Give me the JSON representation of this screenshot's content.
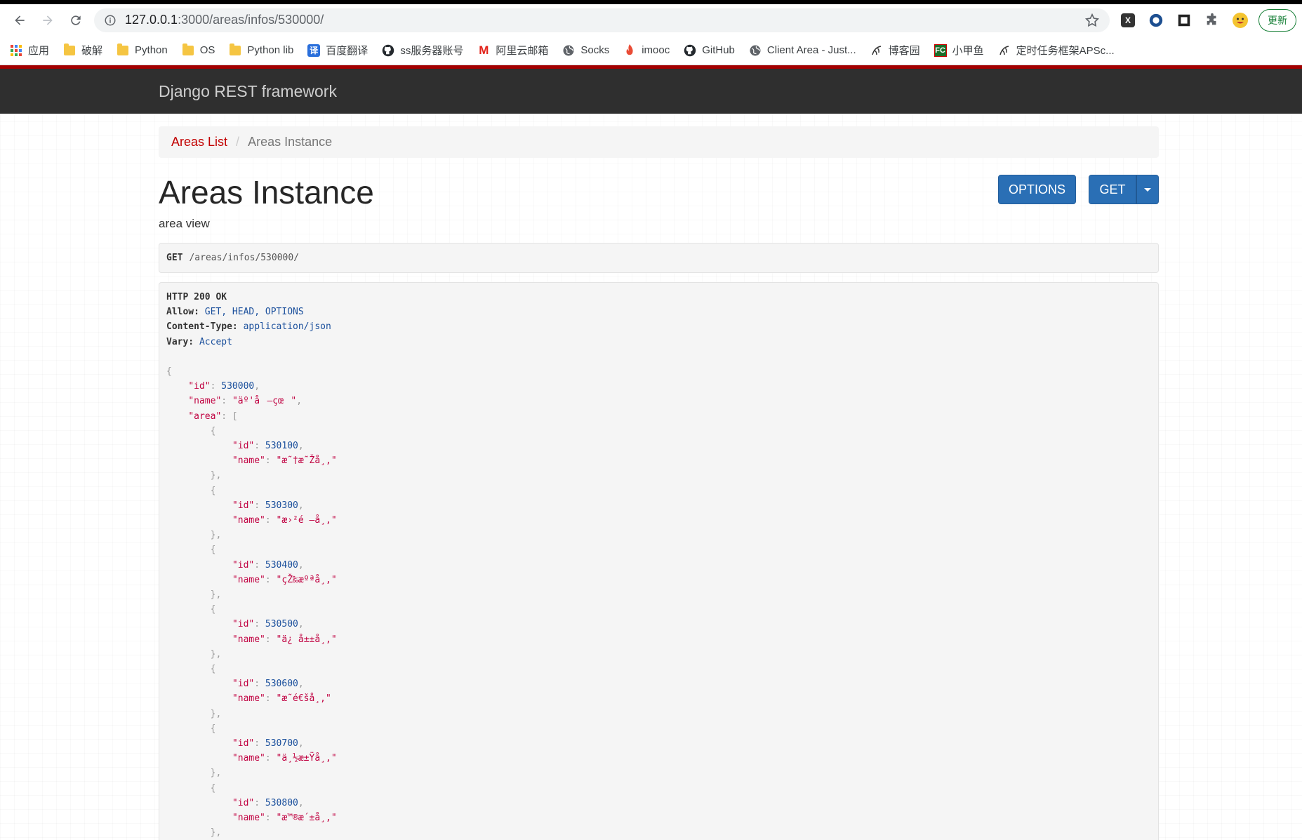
{
  "browser": {
    "url_host": "127.0.0.1",
    "url_path": ":3000/areas/infos/530000/",
    "update_label": "更新"
  },
  "bookmarks": [
    {
      "label": "应用",
      "icon": "apps-grid-icon"
    },
    {
      "label": "破解",
      "icon": "folder-icon"
    },
    {
      "label": "Python",
      "icon": "folder-icon"
    },
    {
      "label": "OS",
      "icon": "folder-icon"
    },
    {
      "label": "Python lib",
      "icon": "folder-icon"
    },
    {
      "label": "百度翻译",
      "icon": "translate-icon"
    },
    {
      "label": "ss服务器账号",
      "icon": "github-icon"
    },
    {
      "label": "阿里云邮箱",
      "icon": "mail-m-icon"
    },
    {
      "label": "Socks",
      "icon": "globe-icon"
    },
    {
      "label": "imooc",
      "icon": "flame-icon"
    },
    {
      "label": "GitHub",
      "icon": "github-icon"
    },
    {
      "label": "Client Area - Just...",
      "icon": "globe-icon"
    },
    {
      "label": "博客园",
      "icon": "blog-icon"
    },
    {
      "label": "小甲鱼",
      "icon": "fc-icon"
    },
    {
      "label": "定时任务框架APSc...",
      "icon": "blog-icon"
    }
  ],
  "drf": {
    "brand": "Django REST framework",
    "breadcrumb": {
      "list": "Areas List",
      "sep": "/",
      "current": "Areas Instance"
    },
    "title": "Areas Instance",
    "description": "area view",
    "buttons": {
      "options": "OPTIONS",
      "get": "GET"
    },
    "request": {
      "method": "GET",
      "path": "/areas/infos/530000/"
    },
    "response": {
      "status": "HTTP 200 OK",
      "headers": [
        {
          "key": "Allow:",
          "value": "GET, HEAD, OPTIONS"
        },
        {
          "key": "Content-Type:",
          "value": "application/json"
        },
        {
          "key": "Vary:",
          "value": "Accept"
        }
      ],
      "id": "530000",
      "name": "\"äº'å—çœ\"",
      "areas": [
        {
          "id": "530100",
          "name": "\"æ˜†æ˜Žå¸‚\""
        },
        {
          "id": "530300",
          "name": "\"æ›²é–å¸‚\""
        },
        {
          "id": "530400",
          "name": "\"çŽ‰æºªå¸‚\""
        },
        {
          "id": "530500",
          "name": "\"ä¿å±±å¸‚\""
        },
        {
          "id": "530600",
          "name": "\"æ˜­é€šå¸‚\""
        },
        {
          "id": "530700",
          "name": "\"ä¸½æ±Ÿå¸‚\""
        },
        {
          "id": "530800",
          "name": "\"æ™®æ´±å¸‚\""
        }
      ]
    }
  }
}
